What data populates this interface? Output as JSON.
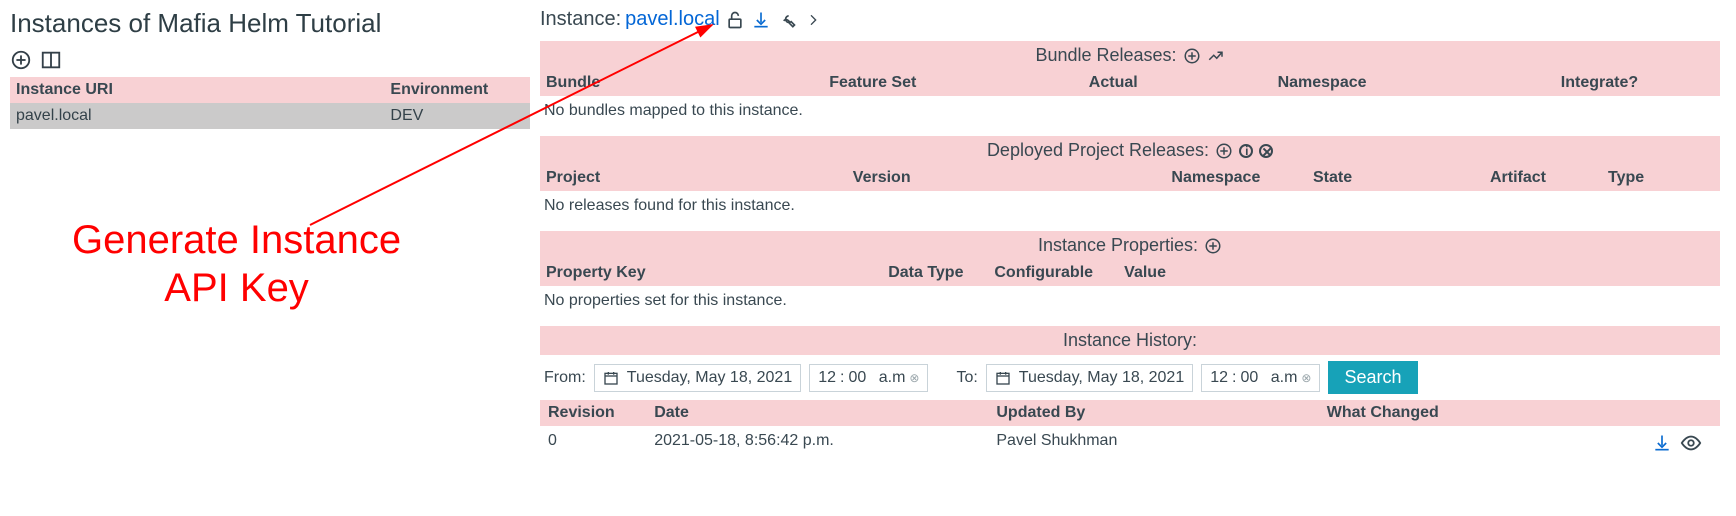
{
  "page_title": "Instances of Mafia Helm Tutorial",
  "instances_table": {
    "headers": [
      "Instance URI",
      "Environment"
    ],
    "row": {
      "uri": "pavel.local",
      "env": "DEV"
    }
  },
  "annotation": {
    "line1": "Generate Instance",
    "line2": "API Key"
  },
  "instance_header": {
    "label": "Instance:",
    "name": "pavel.local"
  },
  "bundle_releases": {
    "title": "Bundle Releases:",
    "headers": [
      "Bundle",
      "Feature Set",
      "Actual",
      "Namespace",
      "Integrate?"
    ],
    "empty": "No bundles mapped to this instance."
  },
  "deployed": {
    "title": "Deployed Project Releases:",
    "headers": [
      "Project",
      "Version",
      "Namespace",
      "State",
      "Artifact",
      "Type"
    ],
    "empty": "No releases found for this instance."
  },
  "properties": {
    "title": "Instance Properties:",
    "headers": [
      "Property Key",
      "Data Type",
      "Configurable",
      "Value"
    ],
    "empty": "No properties set for this instance."
  },
  "history": {
    "title": "Instance History:",
    "from_label": "From:",
    "to_label": "To:",
    "date_value": "Tuesday, May 18, 2021",
    "time_h": "12",
    "time_m": "00",
    "ampm": "a.m",
    "search_label": "Search",
    "headers": [
      "Revision",
      "Date",
      "Updated By",
      "What Changed"
    ],
    "row": {
      "revision": "0",
      "date": "2021-05-18, 8:56:42 p.m.",
      "updated_by": "Pavel Shukhman",
      "what_changed": ""
    }
  }
}
